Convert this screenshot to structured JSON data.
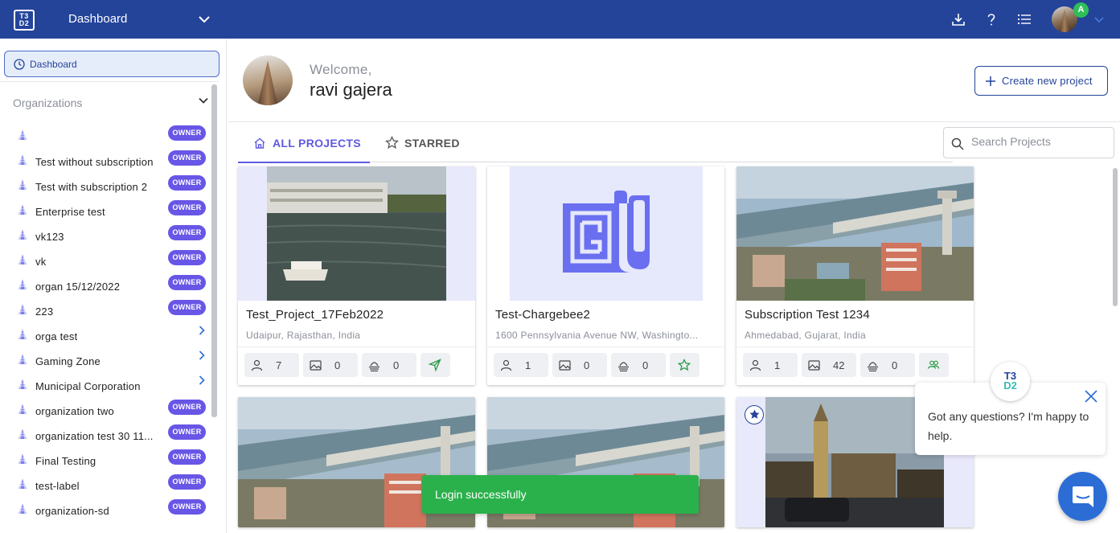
{
  "header": {
    "logo_text": "T3 D2",
    "title": "Dashboard",
    "avatar_badge": "A",
    "icons": [
      "download-icon",
      "help-icon",
      "list-icon",
      "chevron-down-icon"
    ],
    "color": "#24449a"
  },
  "sidebar": {
    "dashboard_label": "Dashboard",
    "organizations_heading": "Organizations",
    "owner_badge": "OWNER",
    "items": [
      {
        "name": "",
        "role": "OWNER"
      },
      {
        "name": "Test without subscription",
        "role": "OWNER"
      },
      {
        "name": "Test with subscription 2",
        "role": "OWNER"
      },
      {
        "name": "Enterprise test",
        "role": "OWNER"
      },
      {
        "name": "vk123",
        "role": "OWNER"
      },
      {
        "name": "vk",
        "role": "OWNER"
      },
      {
        "name": "organ 15/12/2022",
        "role": "OWNER"
      },
      {
        "name": "223",
        "role": "OWNER"
      },
      {
        "name": "orga test",
        "role": ""
      },
      {
        "name": "Gaming Zone",
        "role": ""
      },
      {
        "name": "Municipal Corporation",
        "role": ""
      },
      {
        "name": "organization two",
        "role": "OWNER"
      },
      {
        "name": "organization test   30 11...",
        "role": "OWNER"
      },
      {
        "name": "Final Testing",
        "role": "OWNER"
      },
      {
        "name": "test-label",
        "role": "OWNER"
      },
      {
        "name": "organization-sd",
        "role": "OWNER"
      }
    ]
  },
  "welcome": {
    "label": "Welcome,",
    "name": "ravi gajera",
    "create_button": "Create new project"
  },
  "tabs": {
    "all": "ALL PROJECTS",
    "starred": "STARRED",
    "active": "all"
  },
  "search": {
    "placeholder": "Search Projects",
    "value": ""
  },
  "projects": [
    {
      "name": "Test_Project_17Feb2022",
      "location": "Udaipur, Rajasthan, India",
      "members": "7",
      "images": "0",
      "layers": "0",
      "action": "send-icon"
    },
    {
      "name": "Test-Chargebee2",
      "location": "1600 Pennsylvania Avenue NW, Washingto...",
      "members": "1",
      "images": "0",
      "layers": "0",
      "action": "star-icon"
    },
    {
      "name": "Subscription Test 1234",
      "location": "Ahmedabad, Gujarat, India",
      "members": "1",
      "images": "42",
      "layers": "0",
      "action": "users-icon"
    }
  ],
  "toast": {
    "message": "Login successfully",
    "color": "#2ab14b"
  },
  "chat": {
    "logo": "T3 D2",
    "message": "Got any questions? I'm happy to help."
  },
  "colors": {
    "primary": "#24449a",
    "accent": "#5f5ae0",
    "owner_badge": "#6856e6",
    "success": "#2ab14b"
  }
}
